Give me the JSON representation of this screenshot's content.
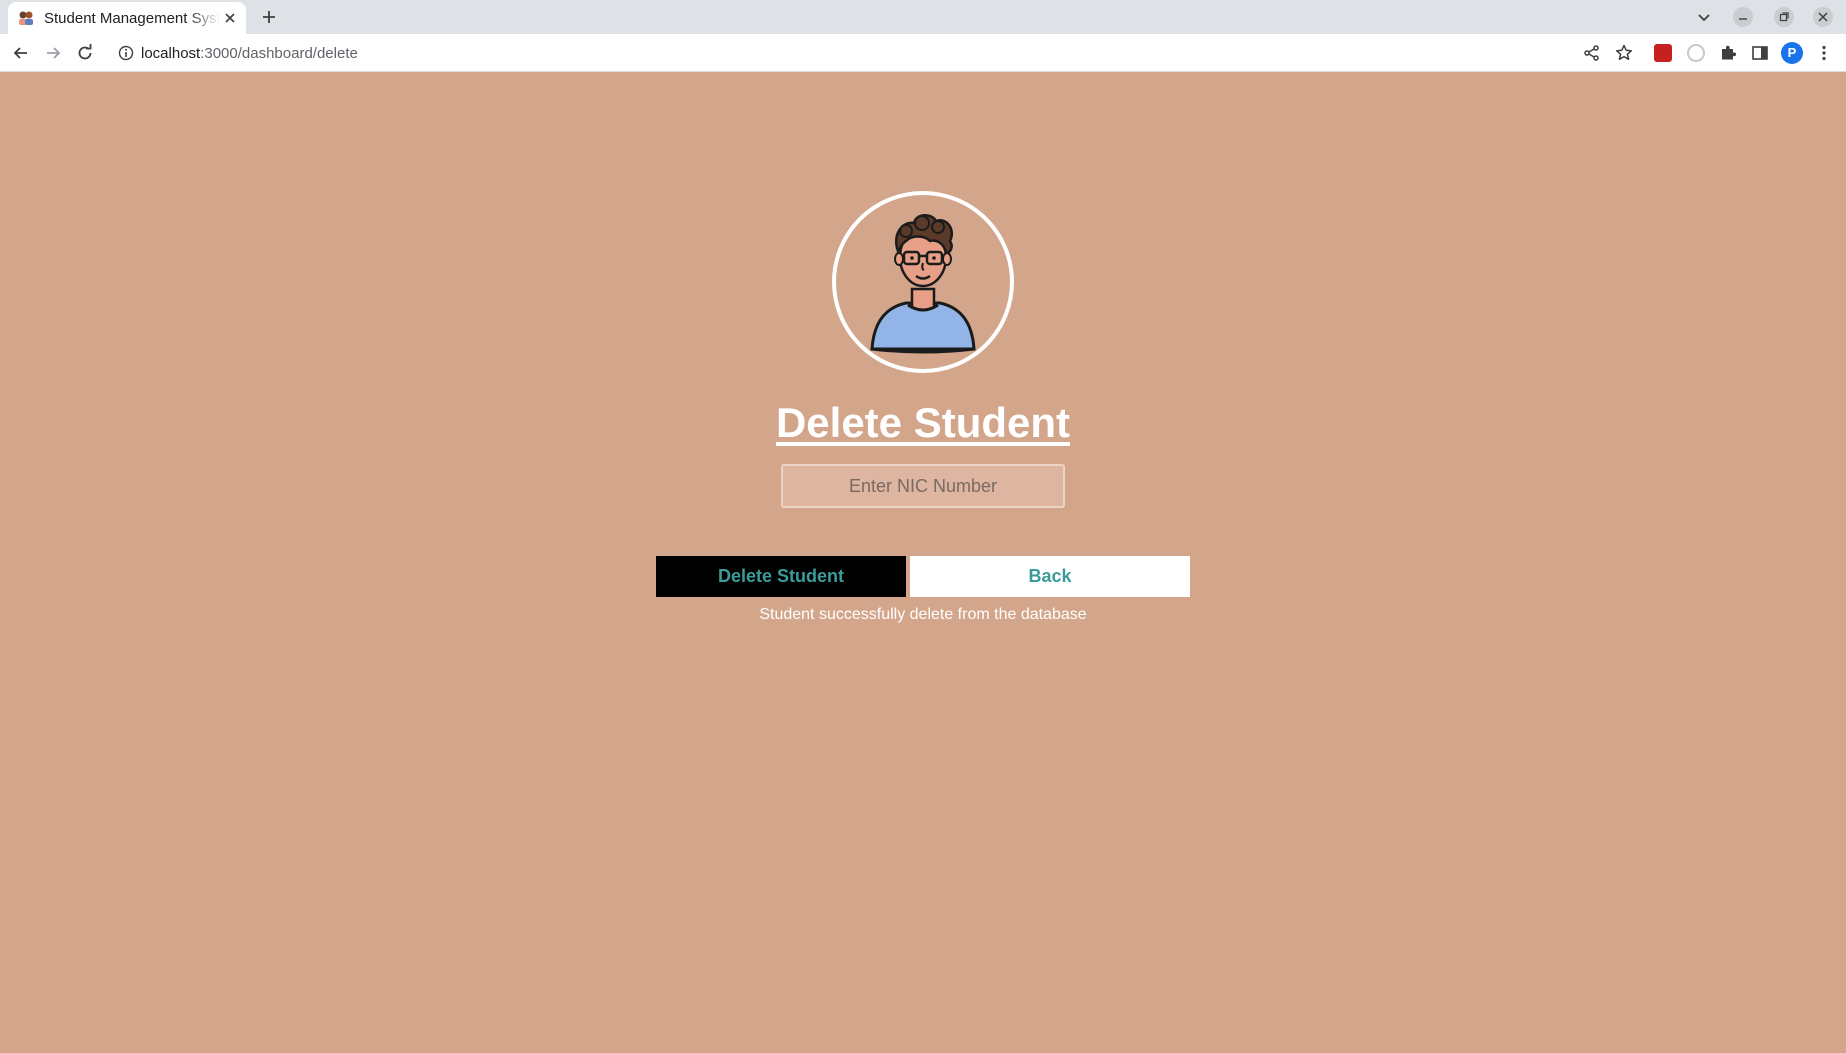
{
  "browser": {
    "tab_title": "Student Management System",
    "url_host": "localhost",
    "url_path": ":3000/dashboard/delete",
    "profile_initial": "P"
  },
  "page": {
    "title": "Delete Student",
    "nic_input": {
      "placeholder": "Enter NIC Number",
      "value": ""
    },
    "delete_button_label": "Delete Student",
    "back_button_label": "Back",
    "status_message": "Student successfully delete from the database"
  },
  "colors": {
    "page_background": "#d3a58a",
    "button_text": "#3a9c9a",
    "delete_button_bg": "#000000",
    "back_button_bg": "#ffffff",
    "title_text": "#ffffff"
  },
  "icons": {
    "avatar": "student-avatar-icon",
    "favicon": "students-favicon-icon"
  }
}
